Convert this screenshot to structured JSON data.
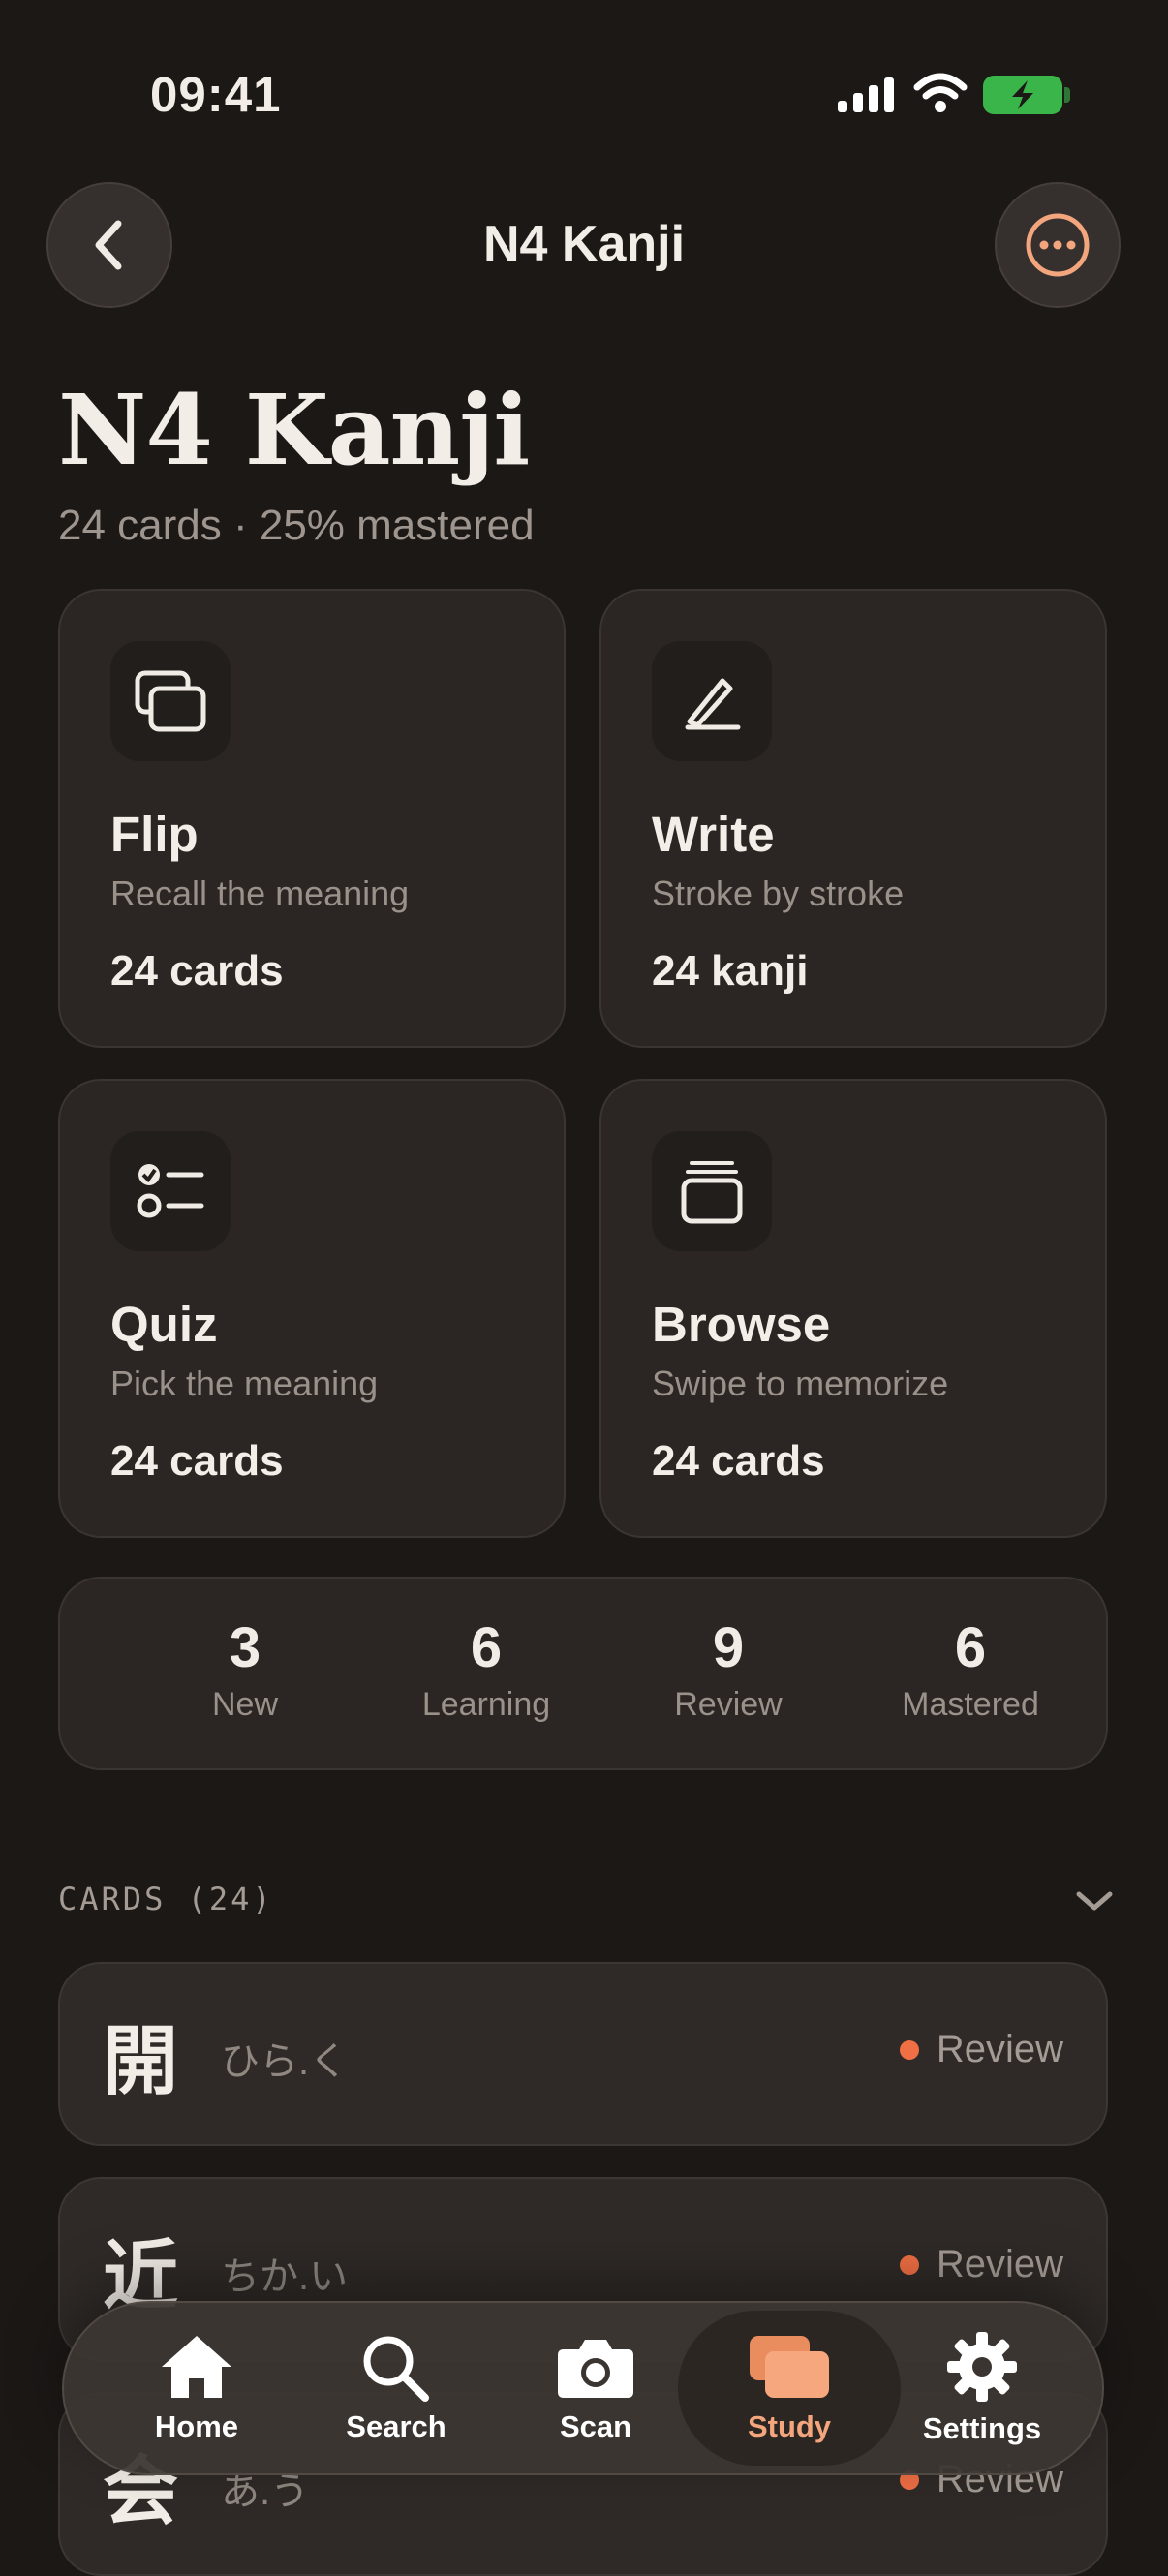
{
  "status_bar": {
    "time": "09:41"
  },
  "nav": {
    "title": "N4 Kanji"
  },
  "header": {
    "title": "N4 Kanji",
    "subtitle": "24 cards · 25% mastered"
  },
  "modes": [
    {
      "name": "Flip",
      "desc": "Recall the meaning",
      "count": "24 cards",
      "icon": "flip-cards-icon"
    },
    {
      "name": "Write",
      "desc": "Stroke by stroke",
      "count": "24 kanji",
      "icon": "pen-icon"
    },
    {
      "name": "Quiz",
      "desc": "Pick the meaning",
      "count": "24 cards",
      "icon": "checklist-icon"
    },
    {
      "name": "Browse",
      "desc": "Swipe to memorize",
      "count": "24 cards",
      "icon": "card-stack-icon"
    }
  ],
  "stats": [
    {
      "value": "3",
      "label": "New"
    },
    {
      "value": "6",
      "label": "Learning"
    },
    {
      "value": "9",
      "label": "Review"
    },
    {
      "value": "6",
      "label": "Mastered"
    }
  ],
  "cards_section": {
    "title": "CARDS (24)"
  },
  "cards": [
    {
      "kanji": "開",
      "reading": "ひら.く",
      "status": "Review"
    },
    {
      "kanji": "近",
      "reading": "ちか.い",
      "status": "Review"
    },
    {
      "kanji": "会",
      "reading": "あ.う",
      "status": "Review"
    }
  ],
  "tabs": [
    {
      "label": "Home",
      "icon": "home-icon"
    },
    {
      "label": "Search",
      "icon": "search-icon"
    },
    {
      "label": "Scan",
      "icon": "camera-icon"
    },
    {
      "label": "Study",
      "icon": "study-cards-icon",
      "active": true
    },
    {
      "label": "Settings",
      "icon": "gear-icon"
    }
  ],
  "colors": {
    "background": "#1c1816",
    "accent": "#f3a57e",
    "status_dot": "#f06f44",
    "battery": "#39b54a"
  }
}
